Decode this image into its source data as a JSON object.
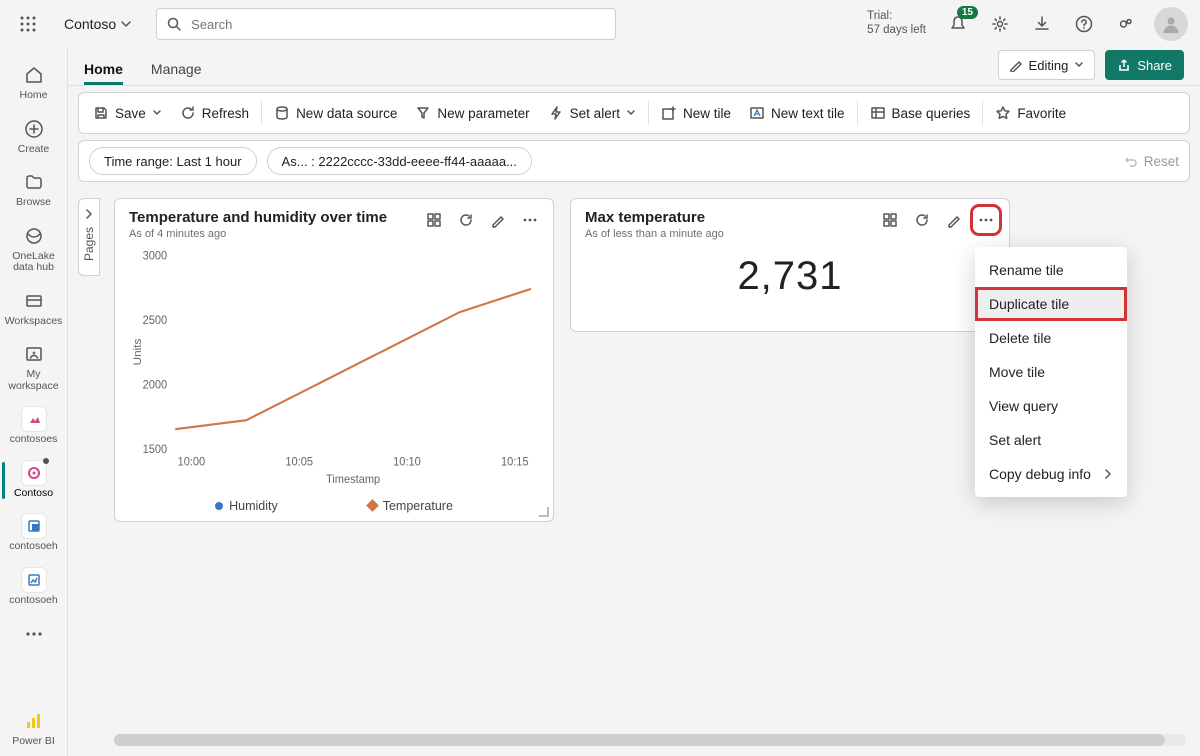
{
  "top": {
    "workspace": "Contoso",
    "search_placeholder": "Search",
    "trial_line1": "Trial:",
    "trial_line2": "57 days left",
    "notifications_badge": "15"
  },
  "rail": {
    "items": [
      {
        "label": "Home"
      },
      {
        "label": "Create"
      },
      {
        "label": "Browse"
      },
      {
        "label": "OneLake data hub"
      },
      {
        "label": "Workspaces"
      },
      {
        "label": "My workspace"
      },
      {
        "label": "contosoes"
      },
      {
        "label": "Contoso"
      },
      {
        "label": "contosoeh"
      },
      {
        "label": "contosoeh"
      }
    ],
    "bottom_label": "Power BI"
  },
  "tabs": {
    "home": "Home",
    "manage": "Manage",
    "editing": "Editing",
    "share": "Share"
  },
  "toolbar": {
    "save": "Save",
    "refresh": "Refresh",
    "new_data_source": "New data source",
    "new_parameter": "New parameter",
    "set_alert": "Set alert",
    "new_tile": "New tile",
    "new_text_tile": "New text tile",
    "base_queries": "Base queries",
    "favorite": "Favorite"
  },
  "params": {
    "time_range": "Time range: Last 1 hour",
    "param2": "As... : 2222cccc-33dd-eeee-ff44-aaaaa...",
    "reset": "Reset"
  },
  "pages_label": "Pages",
  "tile1": {
    "title": "Temperature and humidity over time",
    "subtitle": "As of 4 minutes ago",
    "ylabel": "Units",
    "xlabel": "Timestamp",
    "legend_humidity": "Humidity",
    "legend_temperature": "Temperature"
  },
  "tile2": {
    "title": "Max temperature",
    "subtitle": "As of less than a minute ago",
    "value": "2,731"
  },
  "ctx": {
    "rename": "Rename tile",
    "duplicate": "Duplicate tile",
    "delete": "Delete tile",
    "move": "Move tile",
    "view_query": "View query",
    "set_alert": "Set alert",
    "copy_debug": "Copy debug info"
  },
  "chart_data": {
    "type": "line",
    "title": "Temperature and humidity over time",
    "xlabel": "Timestamp",
    "ylabel": "Units",
    "ylim": [
      1500,
      3000
    ],
    "y_ticks": [
      1500,
      2000,
      2500,
      3000
    ],
    "x_ticks": [
      "10:00",
      "10:05",
      "10:10",
      "10:15"
    ],
    "series": [
      {
        "name": "Temperature",
        "color": "#d27742",
        "x": [
          "09:58",
          "10:00",
          "10:05",
          "10:10",
          "10:15",
          "10:18"
        ],
        "y": [
          1650,
          1720,
          2000,
          2280,
          2560,
          2740
        ]
      }
    ],
    "legend": [
      "Humidity",
      "Temperature"
    ]
  }
}
